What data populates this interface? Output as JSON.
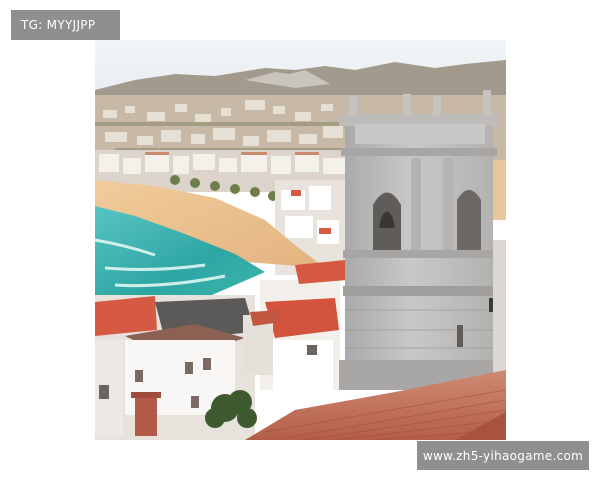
{
  "watermark_top_left": "TG: MYYJJPP",
  "watermark_bottom_right": "www.zh5-yihaogame.com",
  "photo": {
    "subject": "coastal-town-bell-tower-photo",
    "colors": {
      "sky": "#e8eef3",
      "sea": "#3fb2ad",
      "sand": "#e9c08e",
      "stone": "#b9b8b6",
      "roof": "#c6765e"
    }
  }
}
